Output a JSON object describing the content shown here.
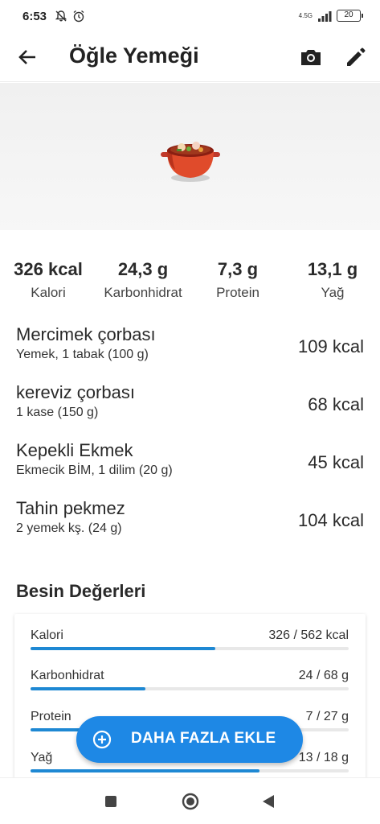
{
  "status_bar": {
    "time": "6:53",
    "network": "4.5G",
    "battery": "20"
  },
  "header": {
    "title": "Öğle Yemeği"
  },
  "icons": {
    "back": "arrow-left-icon",
    "camera": "camera-icon",
    "edit": "pencil-icon",
    "meal": "pot-of-food-icon",
    "add": "plus-circle-icon"
  },
  "summary": [
    {
      "value": "326 kcal",
      "label": "Kalori"
    },
    {
      "value": "24,3 g",
      "label": "Karbonhidrat"
    },
    {
      "value": "7,3 g",
      "label": "Protein"
    },
    {
      "value": "13,1 g",
      "label": "Yağ"
    }
  ],
  "foods": [
    {
      "name": "Mercimek çorbası",
      "desc": "Yemek, 1 tabak (100 g)",
      "kcal": "109 kcal"
    },
    {
      "name": "kereviz çorbası",
      "desc": "1 kase (150 g)",
      "kcal": "68 kcal"
    },
    {
      "name": "Kepekli Ekmek",
      "desc": "Ekmecik BİM, 1 dilim (20 g)",
      "kcal": "45 kcal"
    },
    {
      "name": "Tahin pekmez",
      "desc": "2 yemek kş. (24 g)",
      "kcal": "104 kcal"
    }
  ],
  "nutrition": {
    "title": "Besin Değerleri",
    "rows": [
      {
        "label": "Kalori",
        "value": "326 / 562 kcal",
        "progress": 0.58
      },
      {
        "label": "Karbonhidrat",
        "value": "24 / 68 g",
        "progress": 0.36
      },
      {
        "label": "Protein",
        "value": "7 / 27 g",
        "progress": 0.26
      },
      {
        "label": "Yağ",
        "value": "13 / 18 g",
        "progress": 0.72
      }
    ]
  },
  "fab": {
    "label": "DAHA FAZLA EKLE"
  },
  "colors": {
    "accent": "#1e88e5",
    "progress": "#1e88d3"
  }
}
